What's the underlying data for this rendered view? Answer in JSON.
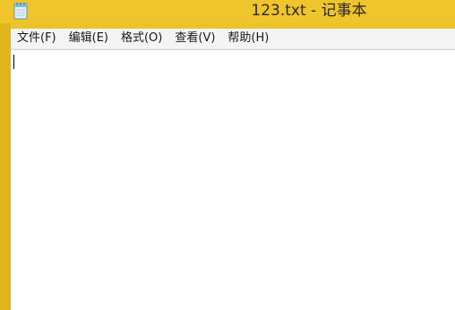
{
  "window": {
    "title": "123.txt - 记事本",
    "frame_color": "#ecc32a",
    "app_icon": "notepad-icon"
  },
  "menubar": {
    "items": [
      {
        "label": "文件(F)"
      },
      {
        "label": "编辑(E)"
      },
      {
        "label": "格式(O)"
      },
      {
        "label": "查看(V)"
      },
      {
        "label": "帮助(H)"
      }
    ]
  },
  "editor": {
    "content": ""
  }
}
